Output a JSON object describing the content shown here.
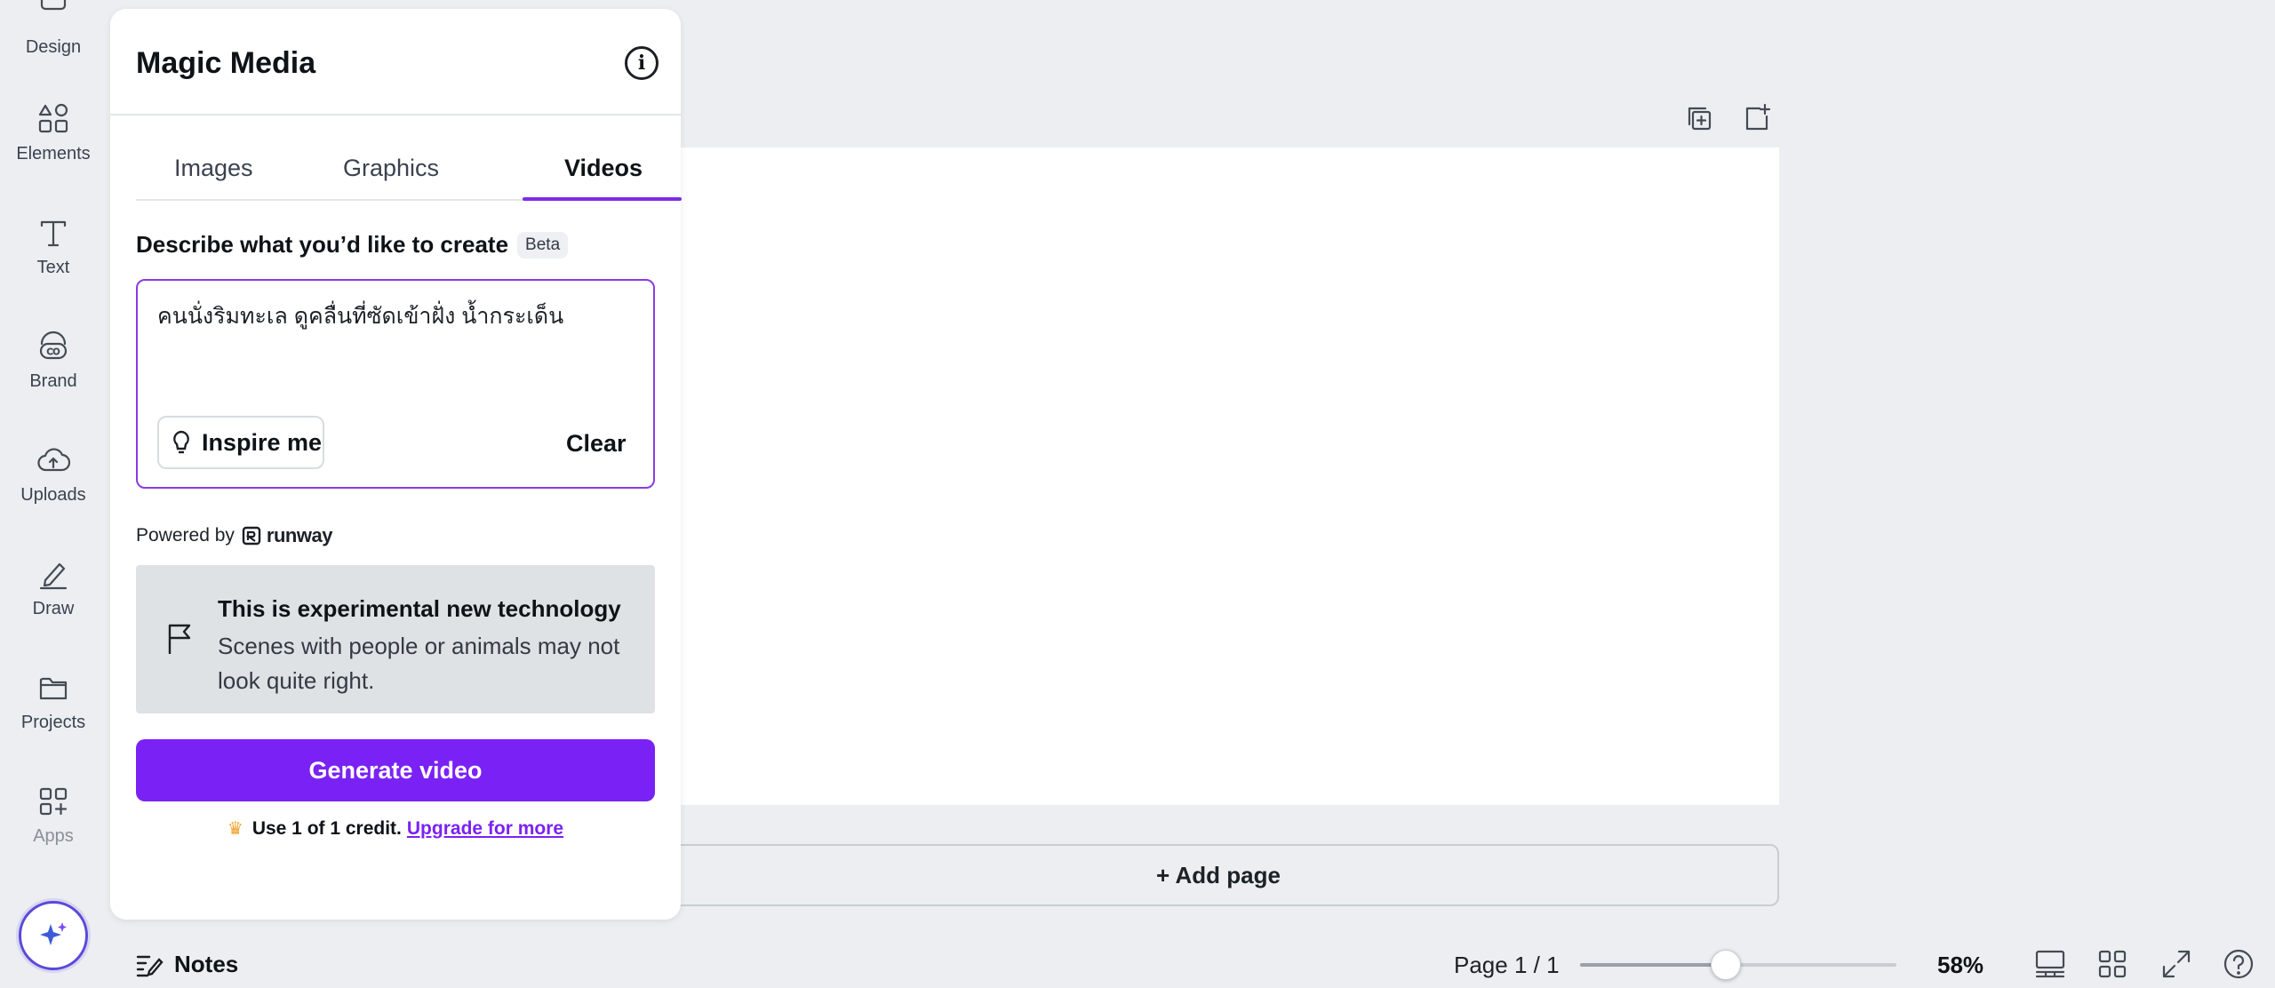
{
  "rail": {
    "items": [
      {
        "label": "Design",
        "icon": "design-icon"
      },
      {
        "label": "Elements",
        "icon": "elements-icon"
      },
      {
        "label": "Text",
        "icon": "text-icon"
      },
      {
        "label": "Brand",
        "icon": "brand-icon"
      },
      {
        "label": "Uploads",
        "icon": "uploads-icon"
      },
      {
        "label": "Draw",
        "icon": "draw-icon"
      },
      {
        "label": "Projects",
        "icon": "folder-icon"
      },
      {
        "label": "Apps",
        "icon": "apps-icon"
      }
    ],
    "magic_button_icon": "sparkle-icon"
  },
  "panel": {
    "title": "Magic Media",
    "tabs": [
      {
        "label": "Images",
        "active": false
      },
      {
        "label": "Graphics",
        "active": false
      },
      {
        "label": "Videos",
        "active": true
      }
    ],
    "describe_label": "Describe what you’d like to create",
    "beta_badge": "Beta",
    "prompt_value": "คนนั่งริมทะเล ดูคลื่นที่ซัดเข้าฝั่ง น้ำกระเด็น",
    "inspire_label": "Inspire me",
    "clear_label": "Clear",
    "powered_by": "Powered by",
    "partner_name": "runway",
    "notice": {
      "title": "This is experimental new technology",
      "body": "Scenes with people or animals may not look quite right."
    },
    "generate_label": "Generate video",
    "credit_text": "Use 1 of 1 credit.",
    "upgrade_link": "Upgrade for more"
  },
  "canvas": {
    "add_page_label": "+ Add page"
  },
  "bottom_bar": {
    "notes_label": "Notes",
    "page_count": "Page 1 / 1",
    "zoom_value": 0.46,
    "zoom_label": "58%"
  },
  "colors": {
    "accent": "#7a22f5",
    "prompt_border": "#8a3be0",
    "background": "#eceef1"
  }
}
